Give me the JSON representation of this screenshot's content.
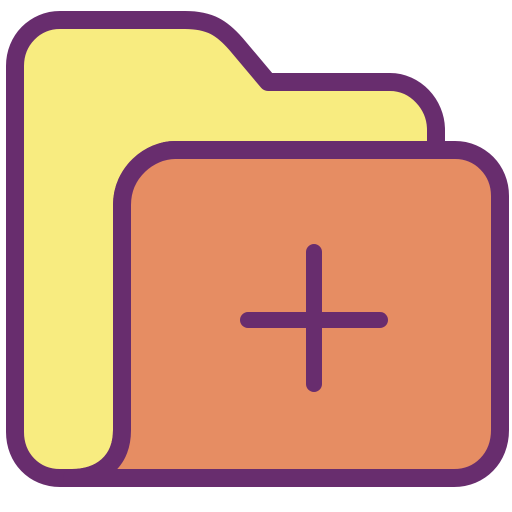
{
  "icon": {
    "name": "add-folder-icon",
    "colors": {
      "outline": "#682d6e",
      "back_folder": "#f8ec80",
      "front_folder": "#e68d63"
    }
  }
}
